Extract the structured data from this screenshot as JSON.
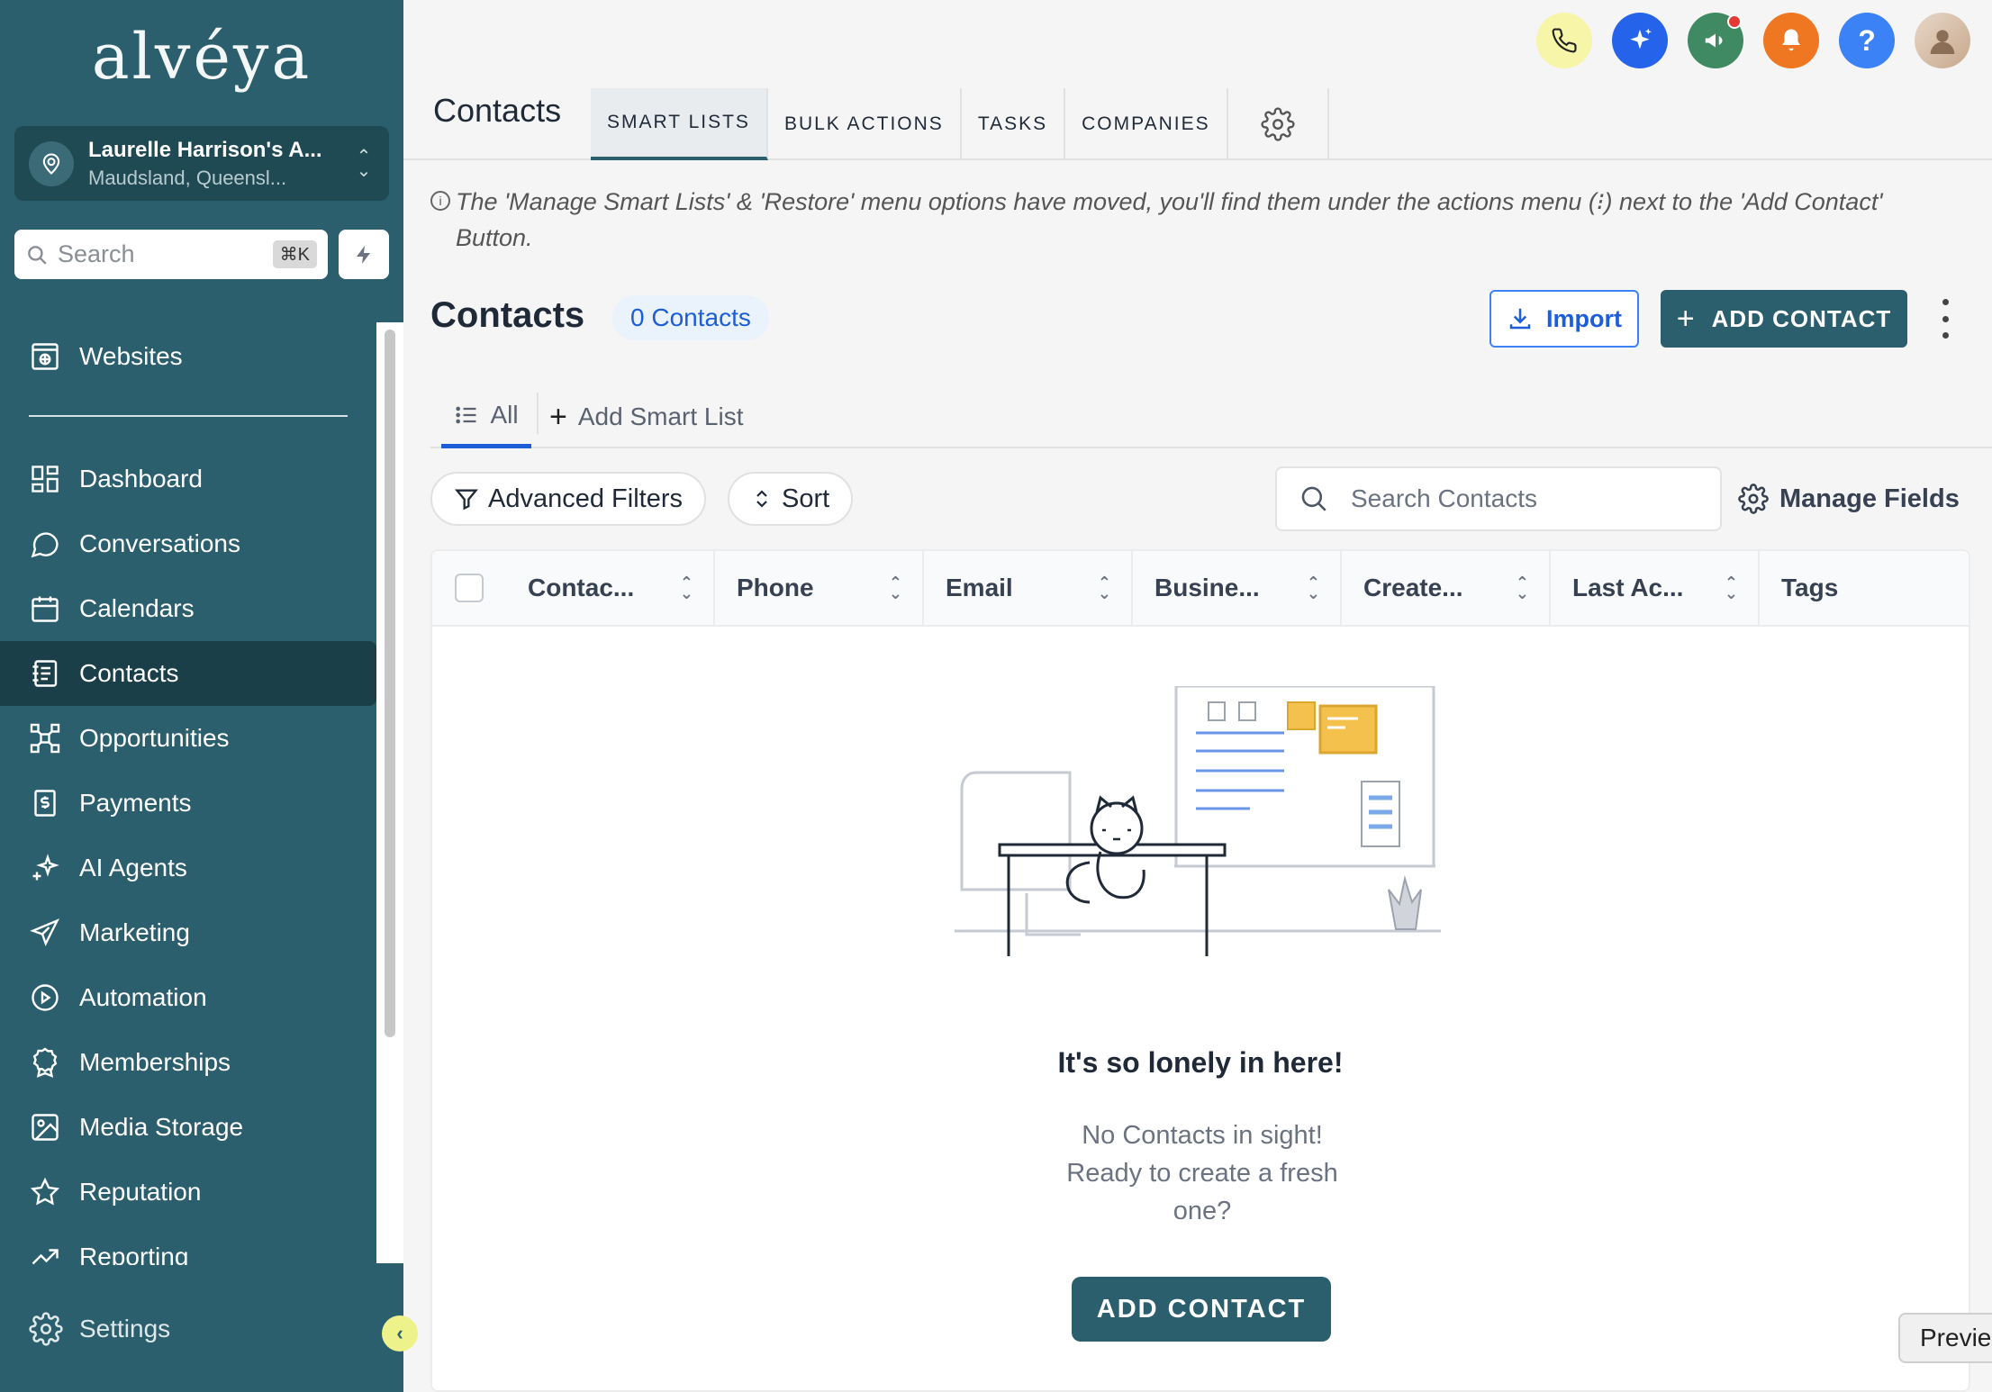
{
  "brand": {
    "logo_text": "alvéya"
  },
  "account": {
    "name": "Laurelle Harrison's A...",
    "location": "Maudsland, Queensl..."
  },
  "sidebar_search": {
    "placeholder": "Search",
    "shortcut": "⌘K"
  },
  "nav_top": {
    "label": "Websites",
    "icon": "globe-window-icon"
  },
  "nav": [
    {
      "label": "Dashboard",
      "icon": "dashboard-grid-icon"
    },
    {
      "label": "Conversations",
      "icon": "chat-bubble-icon"
    },
    {
      "label": "Calendars",
      "icon": "calendar-icon"
    },
    {
      "label": "Contacts",
      "icon": "contact-card-icon",
      "active": true
    },
    {
      "label": "Opportunities",
      "icon": "network-icon"
    },
    {
      "label": "Payments",
      "icon": "dollar-receipt-icon"
    },
    {
      "label": "AI Agents",
      "icon": "sparkle-icon"
    },
    {
      "label": "Marketing",
      "icon": "paper-plane-icon"
    },
    {
      "label": "Automation",
      "icon": "play-circle-icon"
    },
    {
      "label": "Memberships",
      "icon": "award-icon"
    },
    {
      "label": "Media Storage",
      "icon": "image-icon"
    },
    {
      "label": "Reputation",
      "icon": "star-icon"
    },
    {
      "label": "Reporting",
      "icon": "trend-line-icon"
    }
  ],
  "settings_label": "Settings",
  "header": {
    "title": "Contacts",
    "tabs": [
      "SMART LISTS",
      "BULK ACTIONS",
      "TASKS",
      "COMPANIES"
    ]
  },
  "notice": "The 'Manage Smart Lists' & 'Restore' menu options have moved, you'll find them under the actions menu (⁝) next to the 'Add Contact' Button.",
  "section": {
    "title": "Contacts",
    "count": "0 Contacts",
    "import_label": "Import",
    "add_label": "ADD CONTACT"
  },
  "subtabs": {
    "all": "All",
    "add_smart_list": "Add Smart List"
  },
  "toolbar": {
    "advanced_filters": "Advanced Filters",
    "sort": "Sort",
    "search_placeholder": "Search Contacts",
    "manage_fields": "Manage Fields"
  },
  "table": {
    "columns": [
      "Contac...",
      "Phone",
      "Email",
      "Busine...",
      "Create...",
      "Last Ac...",
      "Tags"
    ]
  },
  "empty": {
    "title": "It's so lonely in here!",
    "line1": "No Contacts in sight!",
    "line2": "Ready to create a fresh",
    "line3": "one?",
    "button": "ADD CONTACT"
  },
  "preview_tip": "Previe",
  "colors": {
    "sidebar": "#2c5f6d",
    "accent": "#1d5dd8",
    "primary_button": "#2c5f6d"
  }
}
